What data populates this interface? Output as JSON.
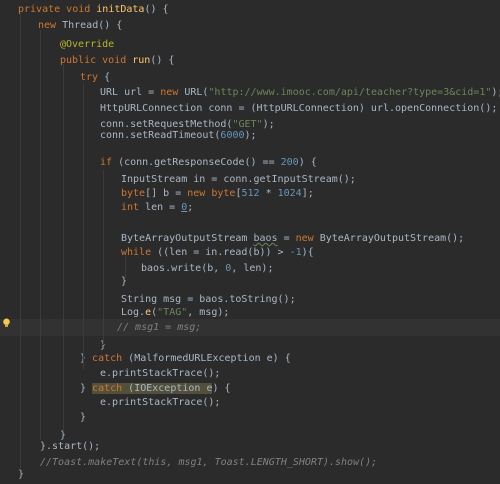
{
  "editor": {
    "lines": [
      [
        [
          "private ",
          "k"
        ],
        [
          "void ",
          "k"
        ],
        [
          "initData",
          "f"
        ],
        [
          "() {",
          ""
        ]
      ],
      [
        [
          "new ",
          "k"
        ],
        [
          "Thread() {",
          ""
        ]
      ],
      [
        [
          "@Override",
          "a"
        ]
      ],
      [
        [
          "public ",
          "k"
        ],
        [
          "void ",
          "k"
        ],
        [
          "run",
          "f"
        ],
        [
          "() {",
          ""
        ]
      ],
      [
        [
          "try ",
          "k"
        ],
        [
          "{",
          ""
        ]
      ],
      [
        [
          "URL url = ",
          ""
        ],
        [
          "new ",
          "k"
        ],
        [
          "URL(",
          ""
        ],
        [
          "\"http://www.imooc.com/api/teacher?type=3&cid=1\"",
          "s"
        ],
        [
          ");",
          ""
        ]
      ],
      [
        [
          "HttpURLConnection conn = (HttpURLConnection) url.openConnection();",
          ""
        ]
      ],
      [
        [
          "conn.setRequestMethod(",
          ""
        ],
        [
          "\"GET\"",
          "s"
        ],
        [
          ");",
          ""
        ]
      ],
      [
        [
          "conn.setReadTimeout(",
          ""
        ],
        [
          "6000",
          "n"
        ],
        [
          ");",
          ""
        ]
      ],
      [],
      [
        [
          "if ",
          "k"
        ],
        [
          "(conn.getResponseCode() == ",
          ""
        ],
        [
          "200",
          "n"
        ],
        [
          ") {",
          ""
        ]
      ],
      [
        [
          "InputStream in = conn.getInputStream();",
          ""
        ]
      ],
      [
        [
          "byte",
          "k"
        ],
        [
          "[] b = ",
          ""
        ],
        [
          "new ",
          "k"
        ],
        [
          "byte",
          "k"
        ],
        [
          "[",
          ""
        ],
        [
          "512 ",
          "n"
        ],
        [
          "* ",
          ""
        ],
        [
          "1024",
          "n"
        ],
        [
          "];",
          ""
        ]
      ],
      [
        [
          "int ",
          "k"
        ],
        [
          "len = ",
          ""
        ],
        [
          "0",
          "n ul"
        ],
        [
          ";",
          ""
        ]
      ],
      [],
      [
        [
          "ByteArrayOutputStream ",
          ""
        ],
        [
          "baos",
          "wavy"
        ],
        [
          " = ",
          ""
        ],
        [
          "new ",
          "k"
        ],
        [
          "ByteArrayOutputStream();",
          ""
        ]
      ],
      [
        [
          "while ",
          "k"
        ],
        [
          "((len = in.read(b)) > ",
          ""
        ],
        [
          "-1",
          "n"
        ],
        [
          "){",
          ""
        ]
      ],
      [
        [
          "baos.write(b, ",
          ""
        ],
        [
          "0",
          "n"
        ],
        [
          ", len);",
          ""
        ]
      ],
      [
        [
          "}",
          ""
        ]
      ],
      [
        [
          "String msg = baos.toString();",
          ""
        ]
      ],
      [
        [
          "Log.",
          ""
        ],
        [
          "e",
          "f"
        ],
        [
          "(",
          ""
        ],
        [
          "\"TAG\"",
          "s"
        ],
        [
          ", msg);",
          ""
        ]
      ],
      [
        [
          "// msg1 = msg;",
          "c"
        ]
      ],
      [
        [
          "}",
          ""
        ]
      ],
      [
        [
          "} ",
          ""
        ],
        [
          "catch ",
          "k"
        ],
        [
          "(MalformedURLException e) {",
          ""
        ]
      ],
      [
        [
          "e.printStackTrace();",
          ""
        ]
      ],
      [
        [
          "} ",
          ""
        ],
        [
          "catch",
          "k hlk"
        ],
        [
          " (IOException e",
          "hlk"
        ],
        [
          ") {",
          ""
        ]
      ],
      [
        [
          "e.printStackTrace();",
          ""
        ]
      ],
      [
        [
          "}",
          ""
        ]
      ],
      [
        [
          "}",
          ""
        ]
      ],
      [
        [
          "}.start();",
          ""
        ]
      ],
      [
        [
          "//Toast.makeText(this, msg1, Toast.LENGTH_SHORT).show();",
          "c"
        ]
      ],
      [
        [
          "}",
          ""
        ]
      ]
    ],
    "colors": {
      "background": "#2b2b2b",
      "keyword": "#cc7832",
      "method": "#ffc66d",
      "string": "#6a8759",
      "number": "#6897bb",
      "annotation": "#bbb529",
      "comment": "#808080",
      "text": "#a9b7c6"
    },
    "gutter_icon": "lightbulb-icon"
  }
}
